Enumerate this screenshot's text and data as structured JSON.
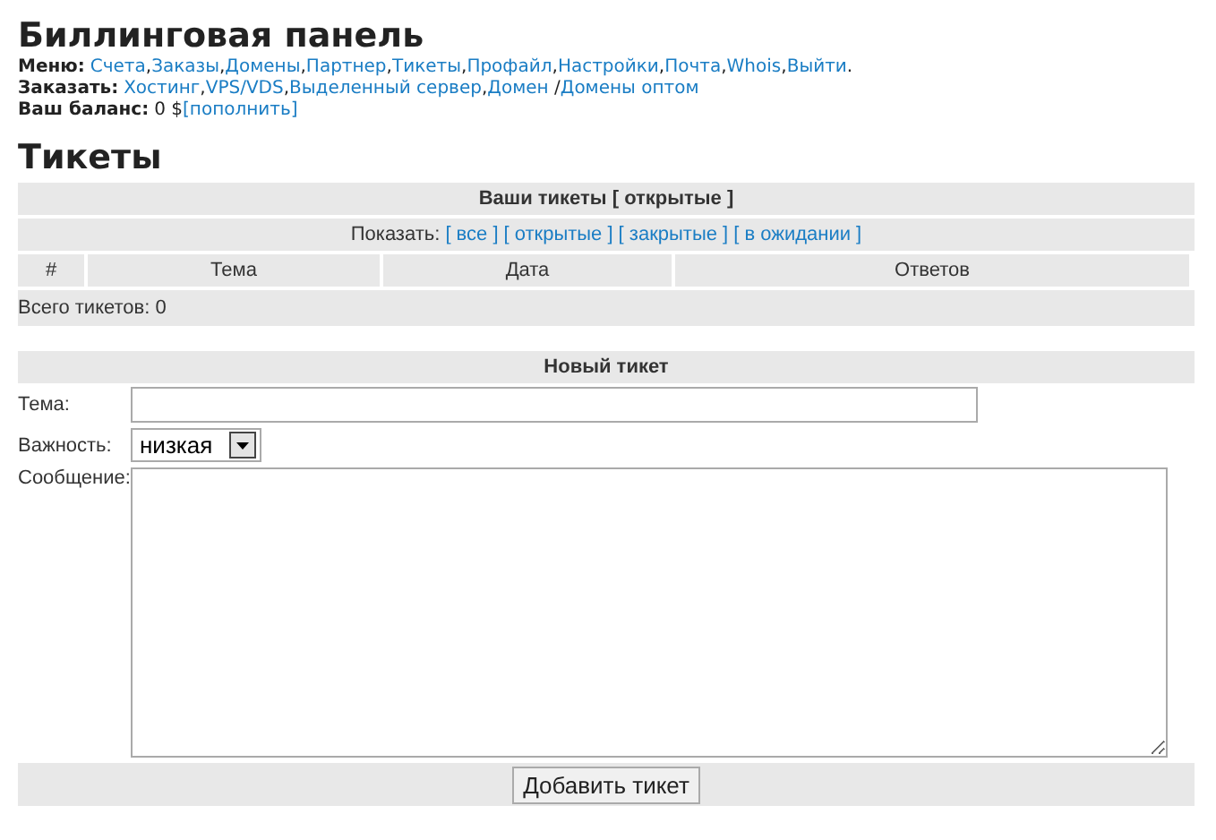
{
  "title": "Биллинговая панель",
  "menu": {
    "label": "Меню:",
    "items": [
      {
        "label": "Счета",
        "after": ","
      },
      {
        "label": "Заказы",
        "after": ","
      },
      {
        "label": "Домены",
        "after": ","
      },
      {
        "label": "Партнер",
        "after": ","
      },
      {
        "label": "Тикеты",
        "after": ","
      },
      {
        "label": "Профайл",
        "after": ","
      },
      {
        "label": "Настройки",
        "after": ","
      },
      {
        "label": "Почта",
        "after": ","
      },
      {
        "label": "Whois",
        "after": ","
      },
      {
        "label": "Выйти",
        "after": "."
      }
    ]
  },
  "order": {
    "label": "Заказать:",
    "items": [
      {
        "label": "Хостинг",
        "after": ","
      },
      {
        "label": "VPS/VDS",
        "after": ","
      },
      {
        "label": "Выделенный сервер",
        "after": ","
      },
      {
        "label": "Домен",
        "after": " /"
      },
      {
        "label": "Домены оптом"
      }
    ]
  },
  "balance": {
    "label": "Ваш баланс:",
    "value": "0 $",
    "link": "[пополнить]"
  },
  "section_title": "Тикеты",
  "tickets": {
    "caption": "Ваши тикеты [ открытые ]",
    "filter_label": "Показать:",
    "filters": [
      "[ все ]",
      "[ открытые ]",
      "[ закрытые ]",
      "[ в ожидании ]"
    ],
    "columns": [
      "#",
      "Тема",
      "Дата",
      "Ответов"
    ],
    "total": "Всего тикетов: 0"
  },
  "new_ticket": {
    "caption": "Новый тикет",
    "subject_label": "Тема:",
    "priority_label": "Важность:",
    "priority": "низкая",
    "message_label": "Сообщение:",
    "submit": "Добавить тикет"
  }
}
